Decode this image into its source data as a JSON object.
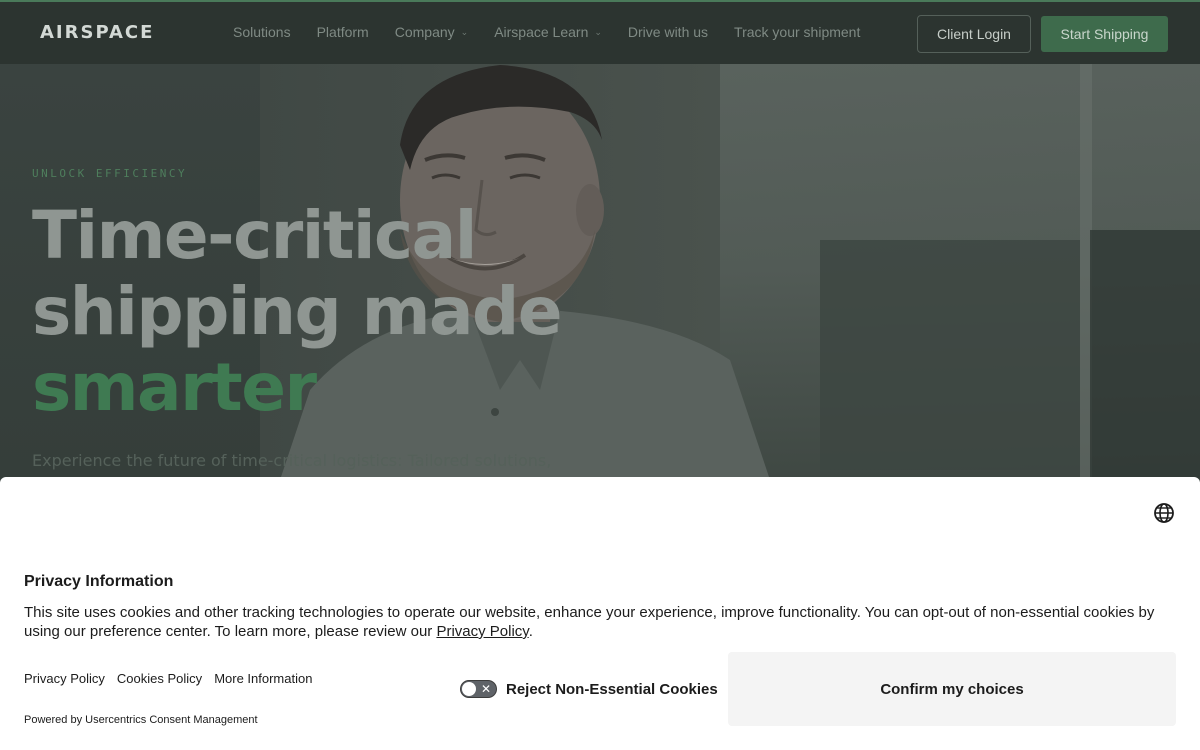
{
  "nav": {
    "logo": "AIRSPACE",
    "links": [
      {
        "label": "Solutions",
        "has_dropdown": false
      },
      {
        "label": "Platform",
        "has_dropdown": false
      },
      {
        "label": "Company",
        "has_dropdown": true
      },
      {
        "label": "Airspace Learn",
        "has_dropdown": true
      },
      {
        "label": "Drive with us",
        "has_dropdown": false
      },
      {
        "label": "Track your shipment",
        "has_dropdown": false
      }
    ],
    "login_label": "Client Login",
    "cta_label": "Start Shipping"
  },
  "hero": {
    "eyebrow": "UNLOCK EFFICIENCY",
    "headline_line1": "Time-critical",
    "headline_line2": "shipping made",
    "headline_accent": "smarter",
    "subtext": "Experience the future of time-critical logistics: Tailored solutions,"
  },
  "cookie_banner": {
    "title": "Privacy Information",
    "body_text": "This site uses cookies and other tracking technologies to operate our website, enhance your experience, improve functionality. You can opt-out of non-essential cookies by using our preference center. To learn more, please review our ",
    "body_link": "Privacy Policy",
    "body_end": ".",
    "footer_links": [
      "Privacy Policy",
      "Cookies Policy",
      "More Information"
    ],
    "powered_by": "Powered by Usercentrics Consent Management",
    "toggle_label": "Reject Non-Essential Cookies",
    "toggle_on": false,
    "confirm_label": "Confirm my choices"
  },
  "colors": {
    "accent": "#3f7a52",
    "nav_bg": "#2c3430",
    "banner_bg": "#ffffff"
  },
  "icons": {
    "globe": "globe-icon",
    "chevron": "chevron-down-icon",
    "toggle_x": "close-icon"
  }
}
